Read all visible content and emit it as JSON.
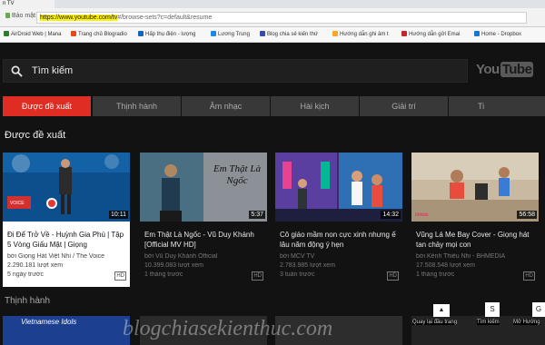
{
  "browser": {
    "tab_title": "n TV",
    "secure_label": "Bảo mật",
    "url_highlight": "https://www.youtube.com/tv",
    "url_rest": "#/browse-sets?c=default&resume",
    "bookmarks": [
      {
        "label": "AirDroid Web | Mana",
        "color": "#2e7d32"
      },
      {
        "label": "Trang chủ Blogradio",
        "color": "#e64a19"
      },
      {
        "label": "Hấp thụ điện - lượng",
        "color": "#1565c0"
      },
      {
        "label": "Lương Trung",
        "color": "#1e88e5"
      },
      {
        "label": "Blog chia sẻ kiến thứ",
        "color": "#3949ab"
      },
      {
        "label": "Hướng dẫn ghi âm t",
        "color": "#f9a825"
      },
      {
        "label": "Hướng dẫn gửi Emai",
        "color": "#c62828"
      },
      {
        "label": "Home - Dropbox",
        "color": "#1976d2"
      }
    ]
  },
  "search": {
    "placeholder": "Tìm kiếm"
  },
  "logo": {
    "you": "You",
    "tube": "Tube"
  },
  "chips": [
    "Được đề xuất",
    "Thịnh hành",
    "Âm nhạc",
    "Hài kịch",
    "Giải trí",
    "Ti"
  ],
  "section_title": "Được đề xuất",
  "section2_title": "Thịnh hành",
  "videos": [
    {
      "title": "Đi Để Trở Về - Huỳnh Gia Phú | Tập 5 Vòng Giấu Mặt | Giọng",
      "channel": "bởi Giọng Hát Việt Nhí / The Voice",
      "views": "2.290.181 lượt xem",
      "time": "5 ngày trước",
      "duration": "10:11",
      "quality": "HD"
    },
    {
      "title": "Em Thật Là Ngốc - Vũ Duy Khánh [Official MV HD]",
      "channel": "bởi Vũ Duy Khánh Official",
      "views": "10.399.083 lượt xem",
      "time": "1 tháng trước",
      "duration": "5:37",
      "quality": "HD",
      "thumb_text": "Em Thật Là Ngốc"
    },
    {
      "title": "Cô giáo mầm non cực xinh nhưng ế lâu năm động ý hẹn",
      "channel": "bởi MCV TV",
      "views": "2.783.985 lượt xem",
      "time": "3 tuần trước",
      "duration": "14:32",
      "quality": "HD"
    },
    {
      "title": "Vũng Lá Me Bay Cover - Giọng hát tan chảy mọi con",
      "channel": "bởi Kênh Thiếu Nhi - BHMEDIA",
      "views": "17.508.548 lượt xem",
      "time": "1 tháng trước",
      "duration": "56:58",
      "quality": "HD"
    }
  ],
  "bottom": {
    "thumb_text": "Vietnamese Idols",
    "watermark": "blogchiasekienthuc.com",
    "labels": [
      "Quay lại đầu trang",
      "Tìm kiếm",
      "Mở Hướng"
    ],
    "keys": [
      "▲",
      "S",
      "G"
    ]
  }
}
